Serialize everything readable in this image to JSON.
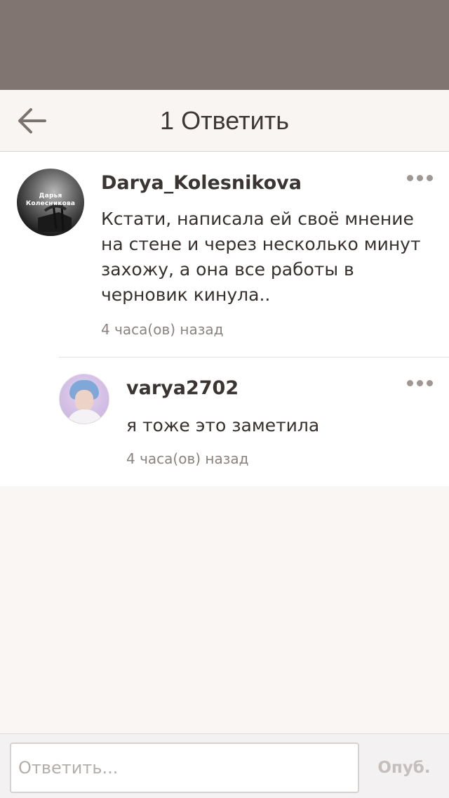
{
  "colors": {
    "status_bar": "#807570",
    "header_background": "#f8f5f2",
    "page_background": "#f9f6f3",
    "text_primary": "#35302d",
    "text_secondary": "#8a8380",
    "footer_background": "#f4f1f3"
  },
  "header": {
    "title": "1 Ответить",
    "back_icon": "arrow-left-icon"
  },
  "comments": [
    {
      "username": "Darya_Kolesnikova",
      "avatar_caption": "Дарья Колесникова",
      "text": "Кстати, написала ей своё мнение на стене и через несколько минут захожу, а она все работы в черновик кинула..",
      "timestamp": "4 часа(ов) назад",
      "more_icon": "more-dots-icon"
    }
  ],
  "replies": [
    {
      "username": "varya2702",
      "text": "я тоже это заметила",
      "timestamp": "4 часа(ов) назад",
      "more_icon": "more-dots-icon"
    }
  ],
  "footer": {
    "reply_placeholder": "Ответить...",
    "reply_value": "",
    "publish_label": "Опуб."
  }
}
